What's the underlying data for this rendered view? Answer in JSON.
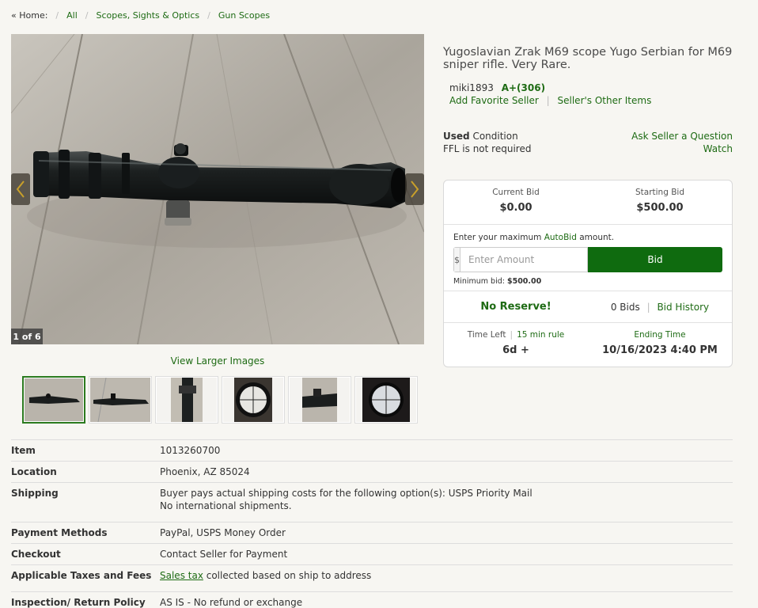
{
  "breadcrumb": {
    "home": "« Home:",
    "items": [
      "All",
      "Scopes, Sights & Optics",
      "Gun Scopes"
    ]
  },
  "gallery": {
    "counter": "1 of 6",
    "view_larger": "View Larger Images",
    "thumbnail_count": 6
  },
  "listing": {
    "title": "Yugoslavian Zrak M69 scope Yugo Serbian for M69 sniper rifle. Very Rare.",
    "seller_name": "miki1893",
    "seller_rating": "A+(306)",
    "add_favorite": "Add Favorite Seller",
    "other_items": "Seller's Other Items",
    "condition_bold": "Used",
    "condition_rest": " Condition",
    "ffl": "FFL is not required",
    "ask_seller": "Ask Seller a Question",
    "watch": "Watch"
  },
  "bid": {
    "current_label": "Current Bid",
    "current_value": "$0.00",
    "starting_label": "Starting Bid",
    "starting_value": "$500.00",
    "enter_prefix": "Enter your maximum ",
    "autobid": "AutoBid",
    "enter_suffix": " amount.",
    "dollar": "$",
    "placeholder": "Enter Amount",
    "button": "Bid",
    "min_label": "Minimum bid: ",
    "min_value": "$500.00",
    "no_reserve": "No Reserve!",
    "bids_count": "0 Bids",
    "bid_history": "Bid History",
    "time_left_label": "Time Left",
    "rule_link": "15 min rule",
    "time_left_value": "6d +",
    "ending_label": "Ending Time",
    "ending_value": "10/16/2023 4:40 PM"
  },
  "details": {
    "item_label": "Item",
    "item_value": "1013260700",
    "location_label": "Location",
    "location_value": "Phoenix, AZ 85024",
    "shipping_label": "Shipping",
    "shipping_line1": "Buyer pays actual shipping costs for the following option(s): USPS Priority Mail",
    "shipping_line2": "No international shipments.",
    "payment_label": "Payment Methods",
    "payment_value": "PayPal, USPS Money Order",
    "checkout_label": "Checkout",
    "checkout_value": "Contact Seller for Payment",
    "taxes_label": "Applicable Taxes and Fees",
    "taxes_link": "Sales tax",
    "taxes_rest": " collected based on ship to address",
    "return_label": "Inspection/ Return Policy",
    "return_value": "AS IS - No refund or exchange"
  },
  "colors": {
    "accent_green": "#0f6b0f",
    "link_green": "#1e6b14",
    "background": "#f7f6f2"
  }
}
